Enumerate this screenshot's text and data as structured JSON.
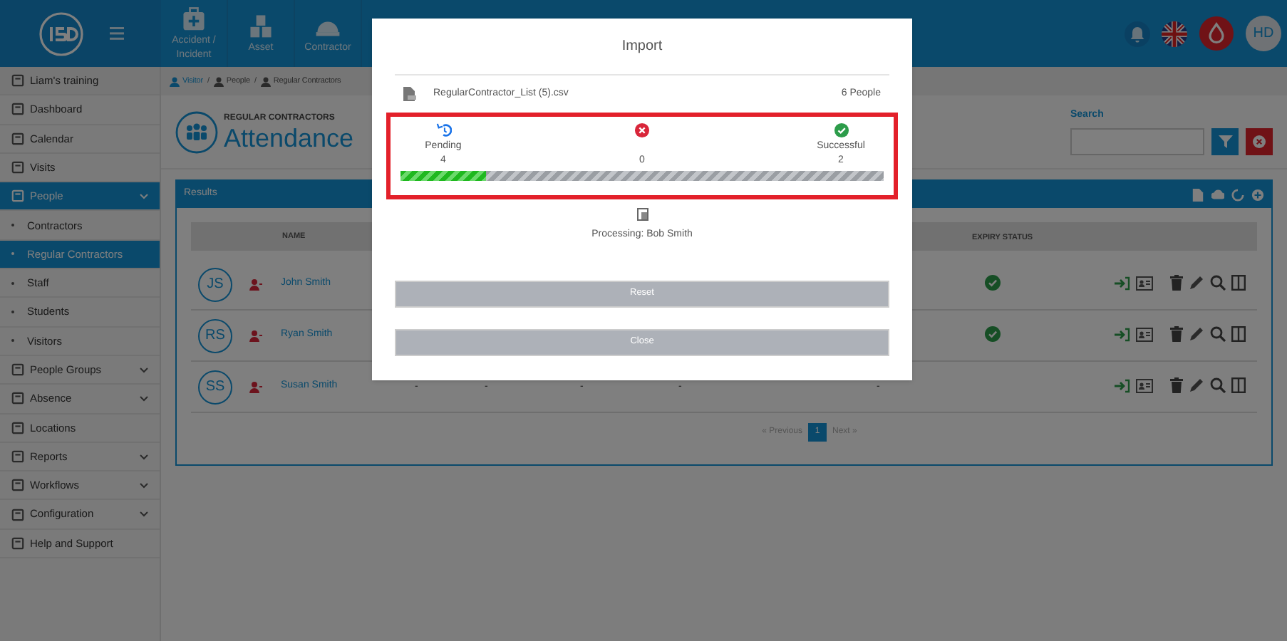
{
  "top_bar": {
    "nav_tabs": [
      {
        "kind": "labeled",
        "label": "Accident / Incident"
      },
      {
        "kind": "labeled",
        "label": "Asset"
      },
      {
        "kind": "labeled",
        "label": "Contractor"
      }
    ],
    "user_initials": "HD"
  },
  "sidebar": {
    "items": [
      {
        "label": "Liam's training",
        "kind": "workspace",
        "selected": false
      },
      {
        "label": "Dashboard",
        "kind": "link",
        "selected": false
      },
      {
        "label": "Calendar",
        "kind": "link",
        "selected": false
      },
      {
        "label": "Visits",
        "kind": "link",
        "selected": false
      },
      {
        "label": "People",
        "kind": "group",
        "selected": true
      },
      {
        "label": "Contractors",
        "kind": "sub",
        "selected": false
      },
      {
        "label": "Regular Contractors",
        "kind": "sub",
        "selected": true
      },
      {
        "label": "Staff",
        "kind": "sub",
        "selected": false
      },
      {
        "label": "Students",
        "kind": "sub",
        "selected": false
      },
      {
        "label": "Visitors",
        "kind": "sub",
        "selected": false
      },
      {
        "label": "People Groups",
        "kind": "group",
        "selected": false
      },
      {
        "label": "Absence",
        "kind": "group",
        "selected": false
      },
      {
        "label": "Locations",
        "kind": "link",
        "selected": false
      },
      {
        "label": "Reports",
        "kind": "group",
        "selected": false
      },
      {
        "label": "Workflows",
        "kind": "group",
        "selected": false
      },
      {
        "label": "Configuration",
        "kind": "group",
        "selected": false
      },
      {
        "label": "Help and Support",
        "kind": "link",
        "selected": false
      }
    ]
  },
  "breadcrumb": [
    {
      "label": "Visitor",
      "separator": "/"
    },
    {
      "label": "People",
      "separator": "/"
    },
    {
      "label": "Regular Contractors"
    }
  ],
  "page_header": {
    "overline": "REGULAR CONTRACTORS",
    "title": "Attendance",
    "search_label": "Search"
  },
  "results": {
    "title": "Results",
    "columns": [
      "NAME",
      "EXPIRY STATUS"
    ],
    "rows": [
      {
        "initials": "JS",
        "name": "John Smith",
        "expiry_ok": true,
        "dashes": []
      },
      {
        "initials": "RS",
        "name": "Ryan Smith",
        "expiry_ok": true,
        "dashes": []
      },
      {
        "initials": "SS",
        "name": "Susan Smith",
        "expiry_ok": false,
        "dashes": [
          "-",
          "-",
          "-",
          "-",
          "-"
        ]
      }
    ],
    "pagination": {
      "previous": "« Previous",
      "pages": [
        {
          "label": "1",
          "selected": true
        }
      ],
      "next": "Next »"
    }
  },
  "import_dialog": {
    "title": "Import",
    "file_name": "RegularContractor_List (5).csv",
    "people_count": "6 People",
    "stats": [
      {
        "kind": "pending",
        "label": "Pending",
        "value": "4"
      },
      {
        "kind": "failed",
        "value": "0"
      },
      {
        "kind": "successful",
        "label": "Successful",
        "value": "2"
      }
    ],
    "progress": {
      "level": 0.176
    },
    "processing": "Processing: Bob Smith",
    "buttons": [
      "Reset",
      "Close"
    ]
  }
}
